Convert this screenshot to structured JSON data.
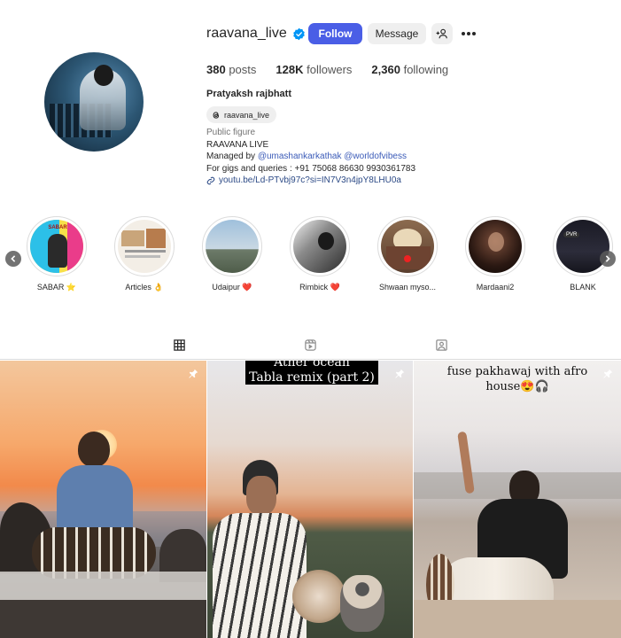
{
  "profile": {
    "username": "raavana_live",
    "full_name": "Pratyaksh rajbhatt",
    "threads_handle": "raavana_live",
    "follow_label": "Follow",
    "message_label": "Message"
  },
  "stats": {
    "posts_count": "380",
    "posts_label": "posts",
    "followers_count": "128K",
    "followers_label": "followers",
    "following_count": "2,360",
    "following_label": "following"
  },
  "bio": {
    "category": "Public figure",
    "line1": "RAAVANA LIVE",
    "managed_by_prefix": "Managed by ",
    "mention1": "@umashankarkathak",
    "mention2": "@worldofvibess",
    "gigs": "For gigs and queries : +91 75068 86630 9930361783",
    "link": "youtu.be/Ld-PTvbj97c?si=IN7V3n4jpY8LHU0a"
  },
  "highlights": [
    {
      "label": "SABAR ⭐",
      "icon": "star-emoji"
    },
    {
      "label": "Articles 👌",
      "icon": "ok-hand-emoji"
    },
    {
      "label": "Udaipur ❤️",
      "icon": "heart-emoji"
    },
    {
      "label": "Rimbick ❤️",
      "icon": "heart-emoji"
    },
    {
      "label": "Shwaan myso...",
      "icon": ""
    },
    {
      "label": "Mardaani2",
      "icon": ""
    },
    {
      "label": "BLANK",
      "icon": ""
    }
  ],
  "highlight_extras": {
    "blank_badge": "PVR",
    "sabar_badge": "SABAR"
  },
  "tabs": [
    {
      "name": "posts",
      "icon": "grid-icon",
      "active": true
    },
    {
      "name": "reels",
      "icon": "reels-icon",
      "active": false
    },
    {
      "name": "tagged",
      "icon": "tagged-icon",
      "active": false
    }
  ],
  "posts": [
    {
      "caption": "",
      "pinned": true
    },
    {
      "caption_line1": "Tabla remix (part 2)",
      "caption_top": "Ather ocean",
      "pinned": true
    },
    {
      "caption_line1": "fuse pakhawaj with afro",
      "caption_line2": "house😍🎧",
      "pinned": true
    }
  ],
  "colors": {
    "accent": "#4a5ee6",
    "verified": "#0095f6",
    "text": "#262626",
    "muted": "#737373",
    "link": "#2c4a86"
  }
}
